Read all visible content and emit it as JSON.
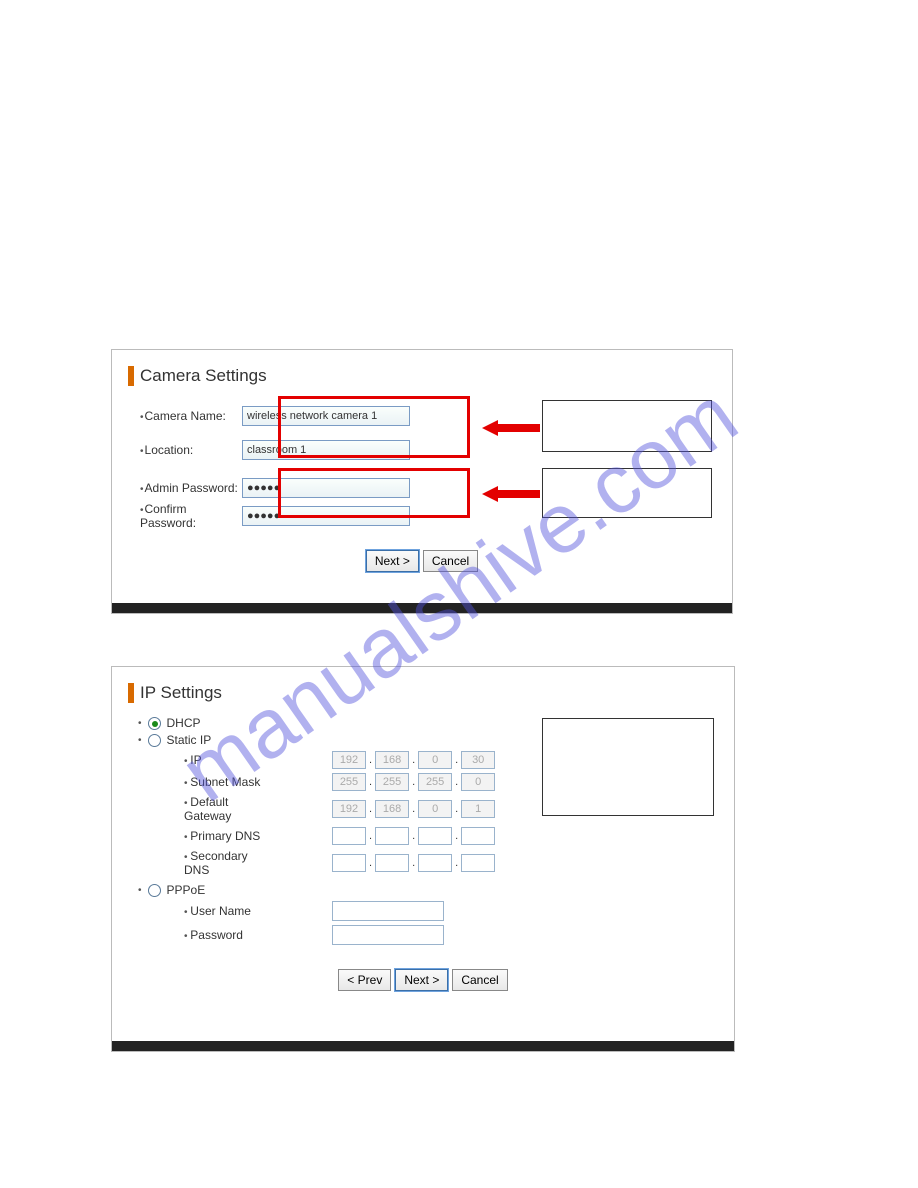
{
  "watermark": "manualshive.com",
  "panel1": {
    "title": "Camera Settings",
    "rows": {
      "camera_name_label": "Camera Name:",
      "camera_name_value": "wireless network camera 1",
      "location_label": "Location:",
      "location_value": "classroom 1",
      "admin_pw_label": "Admin Password:",
      "admin_pw_value": "●●●●●",
      "confirm_pw_label": "Confirm Password:",
      "confirm_pw_value": "●●●●●"
    },
    "buttons": {
      "next": "Next >",
      "cancel": "Cancel"
    }
  },
  "panel2": {
    "title": "IP Settings",
    "radios": {
      "dhcp": "DHCP",
      "static": "Static IP",
      "pppoe": "PPPoE"
    },
    "sub": {
      "ip": "IP",
      "subnet": "Subnet Mask",
      "gateway": "Default Gateway",
      "primary_dns": "Primary DNS",
      "secondary_dns": "Secondary DNS",
      "username": "User Name",
      "password": "Password"
    },
    "values": {
      "ip": [
        "192",
        "168",
        "0",
        "30"
      ],
      "subnet": [
        "255",
        "255",
        "255",
        "0"
      ],
      "gateway": [
        "192",
        "168",
        "0",
        "1"
      ],
      "primary_dns": [
        "",
        "",
        "",
        ""
      ],
      "secondary_dns": [
        "",
        "",
        "",
        ""
      ]
    },
    "buttons": {
      "prev": "< Prev",
      "next": "Next >",
      "cancel": "Cancel"
    }
  }
}
